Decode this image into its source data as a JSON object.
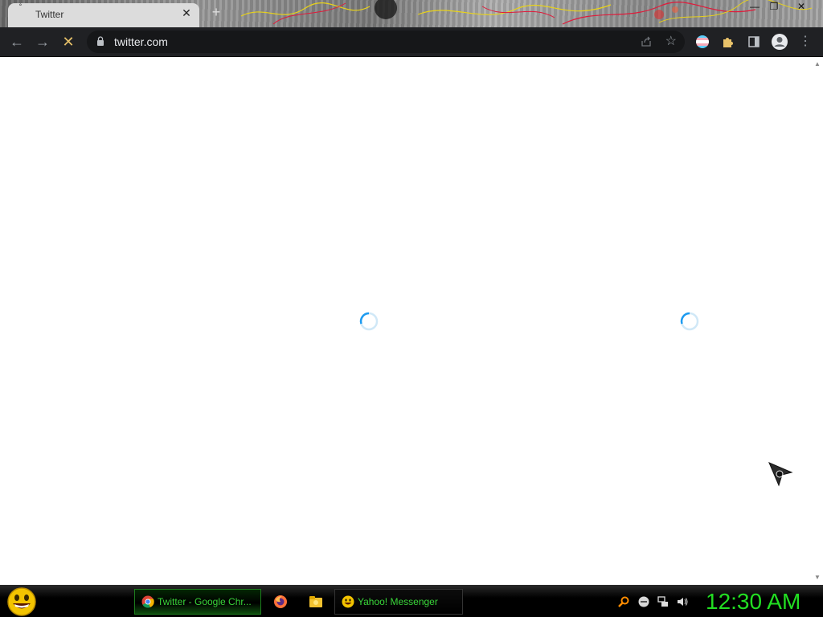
{
  "browser": {
    "tab": {
      "title": "Twitter"
    },
    "address": {
      "url": "twitter.com"
    },
    "icons": [
      "back-icon",
      "forward-icon",
      "stop-icon",
      "lock-icon",
      "share-icon",
      "star-icon",
      "profile-flag-icon",
      "extensions-icon",
      "sidebar-icon",
      "account-icon",
      "menu-icon"
    ]
  },
  "page": {
    "state": "loading",
    "spinner_count": 2
  },
  "taskbar": {
    "tasks": [
      {
        "label": "Twitter - Google Chr...",
        "icon": "chrome-icon",
        "active": true
      },
      {
        "label": "Yahoo! Messenger",
        "icon": "yahoo-messenger-icon",
        "active": false
      }
    ],
    "quick_launch": [
      "firefox-icon",
      "file-explorer-icon"
    ],
    "tray": [
      "search-icon",
      "messenger-status-icon",
      "network-icon",
      "volume-icon"
    ],
    "clock": "12:30 AM"
  },
  "colors": {
    "accent_green": "#22dd22",
    "spinner_blue": "#1d9bf0",
    "toolbar_bg": "#202124"
  }
}
